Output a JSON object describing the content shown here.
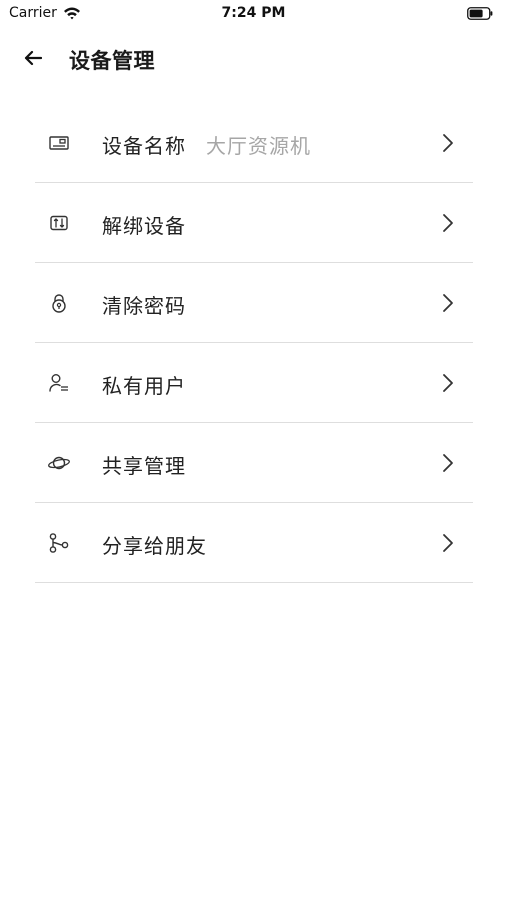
{
  "status_bar": {
    "carrier": "Carrier",
    "time": "7:24 PM",
    "icons": [
      "wifi-icon",
      "battery-icon"
    ]
  },
  "nav": {
    "back_icon": "arrow-left-icon",
    "title": "设备管理"
  },
  "menu": [
    {
      "icon": "device-card-icon",
      "label": "设备名称",
      "value": "大厅资源机",
      "chevron_icon": "chevron-right-icon"
    },
    {
      "icon": "unbind-icon",
      "label": "解绑设备",
      "chevron_icon": "chevron-right-icon"
    },
    {
      "icon": "lock-icon",
      "label": "清除密码",
      "chevron_icon": "chevron-right-icon"
    },
    {
      "icon": "user-list-icon",
      "label": "私有用户",
      "chevron_icon": "chevron-right-icon"
    },
    {
      "icon": "planet-icon",
      "label": "共享管理",
      "chevron_icon": "chevron-right-icon"
    },
    {
      "icon": "share-icon",
      "label": "分享给朋友",
      "chevron_icon": "chevron-right-icon"
    }
  ],
  "colors": {
    "text_primary": "#222222",
    "text_secondary": "#a6a6a6",
    "divider": "#dedede",
    "background": "#ffffff"
  }
}
